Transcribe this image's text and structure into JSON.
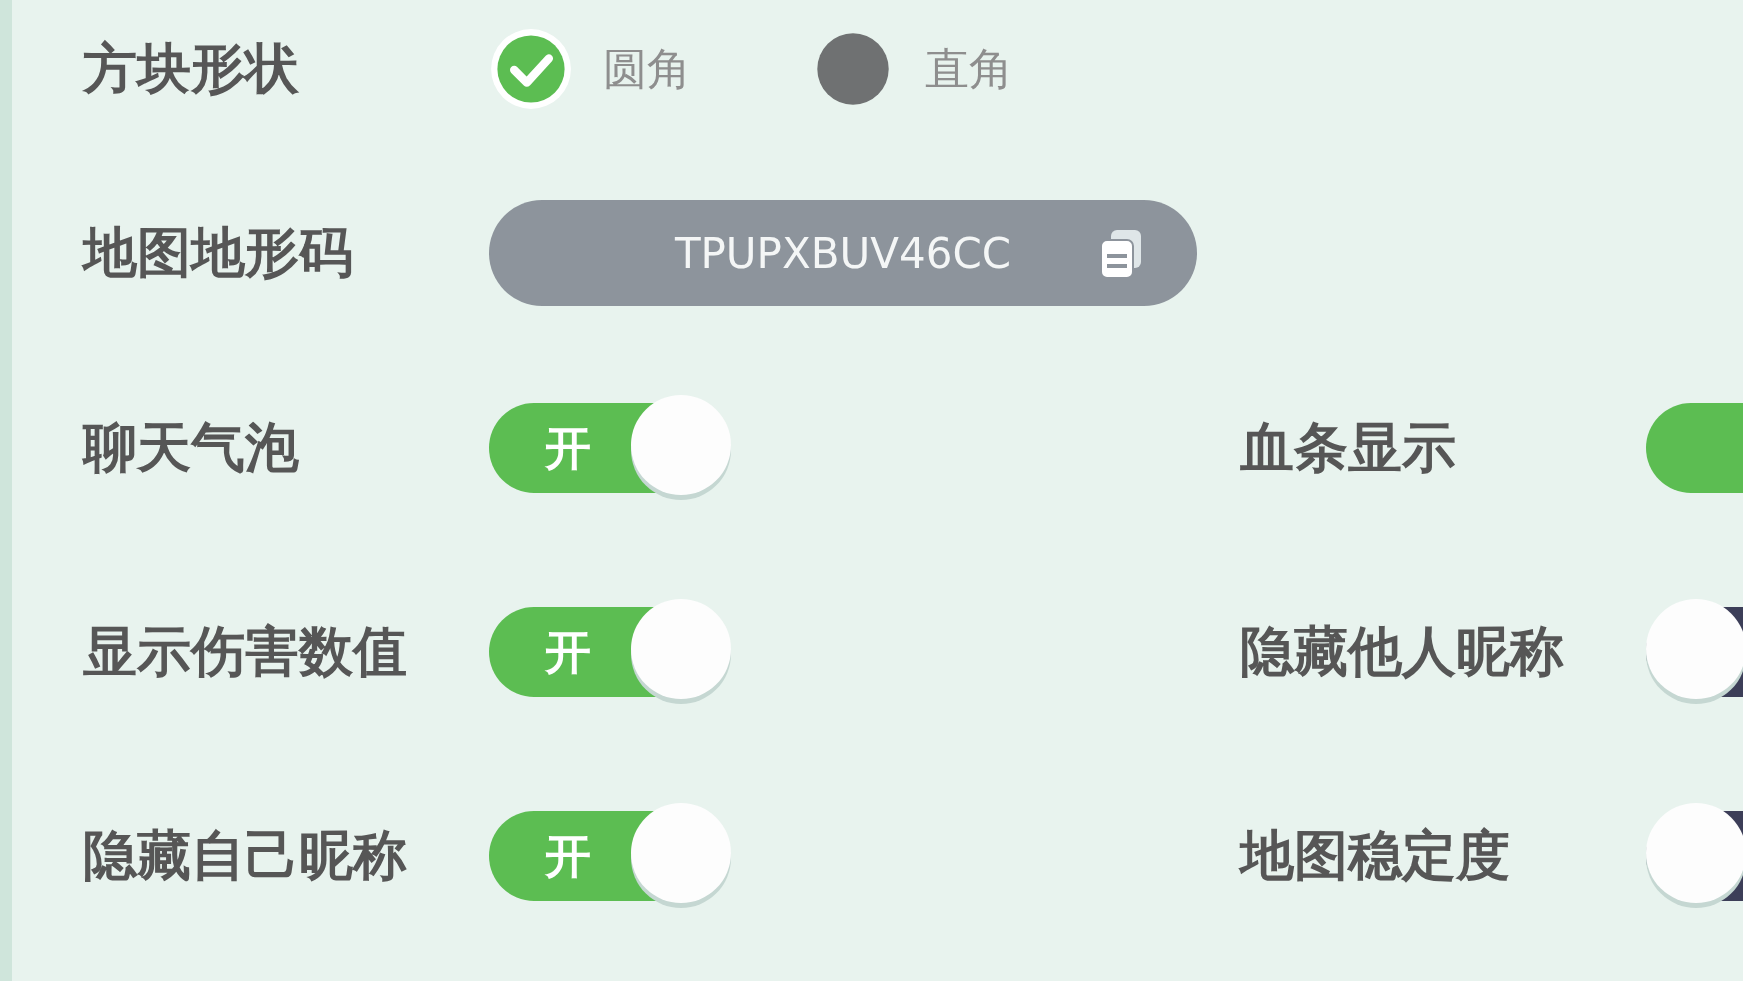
{
  "shape_setting": {
    "label": "方块形状",
    "options": [
      {
        "label": "圆角",
        "selected": true
      },
      {
        "label": "直角",
        "selected": false
      }
    ]
  },
  "terrain_code": {
    "label": "地图地形码",
    "value": "TPUPXBUV46CC"
  },
  "toggle_rows": [
    {
      "left": {
        "label": "聊天气泡",
        "on": true,
        "text": "开"
      },
      "right": {
        "label": "血条显示",
        "on": true
      }
    },
    {
      "left": {
        "label": "显示伤害数值",
        "on": true,
        "text": "开"
      },
      "right": {
        "label": "隐藏他人昵称",
        "on": false
      }
    },
    {
      "left": {
        "label": "隐藏自己昵称",
        "on": true,
        "text": "开"
      },
      "right": {
        "label": "地图稳定度",
        "on": false
      }
    }
  ]
}
